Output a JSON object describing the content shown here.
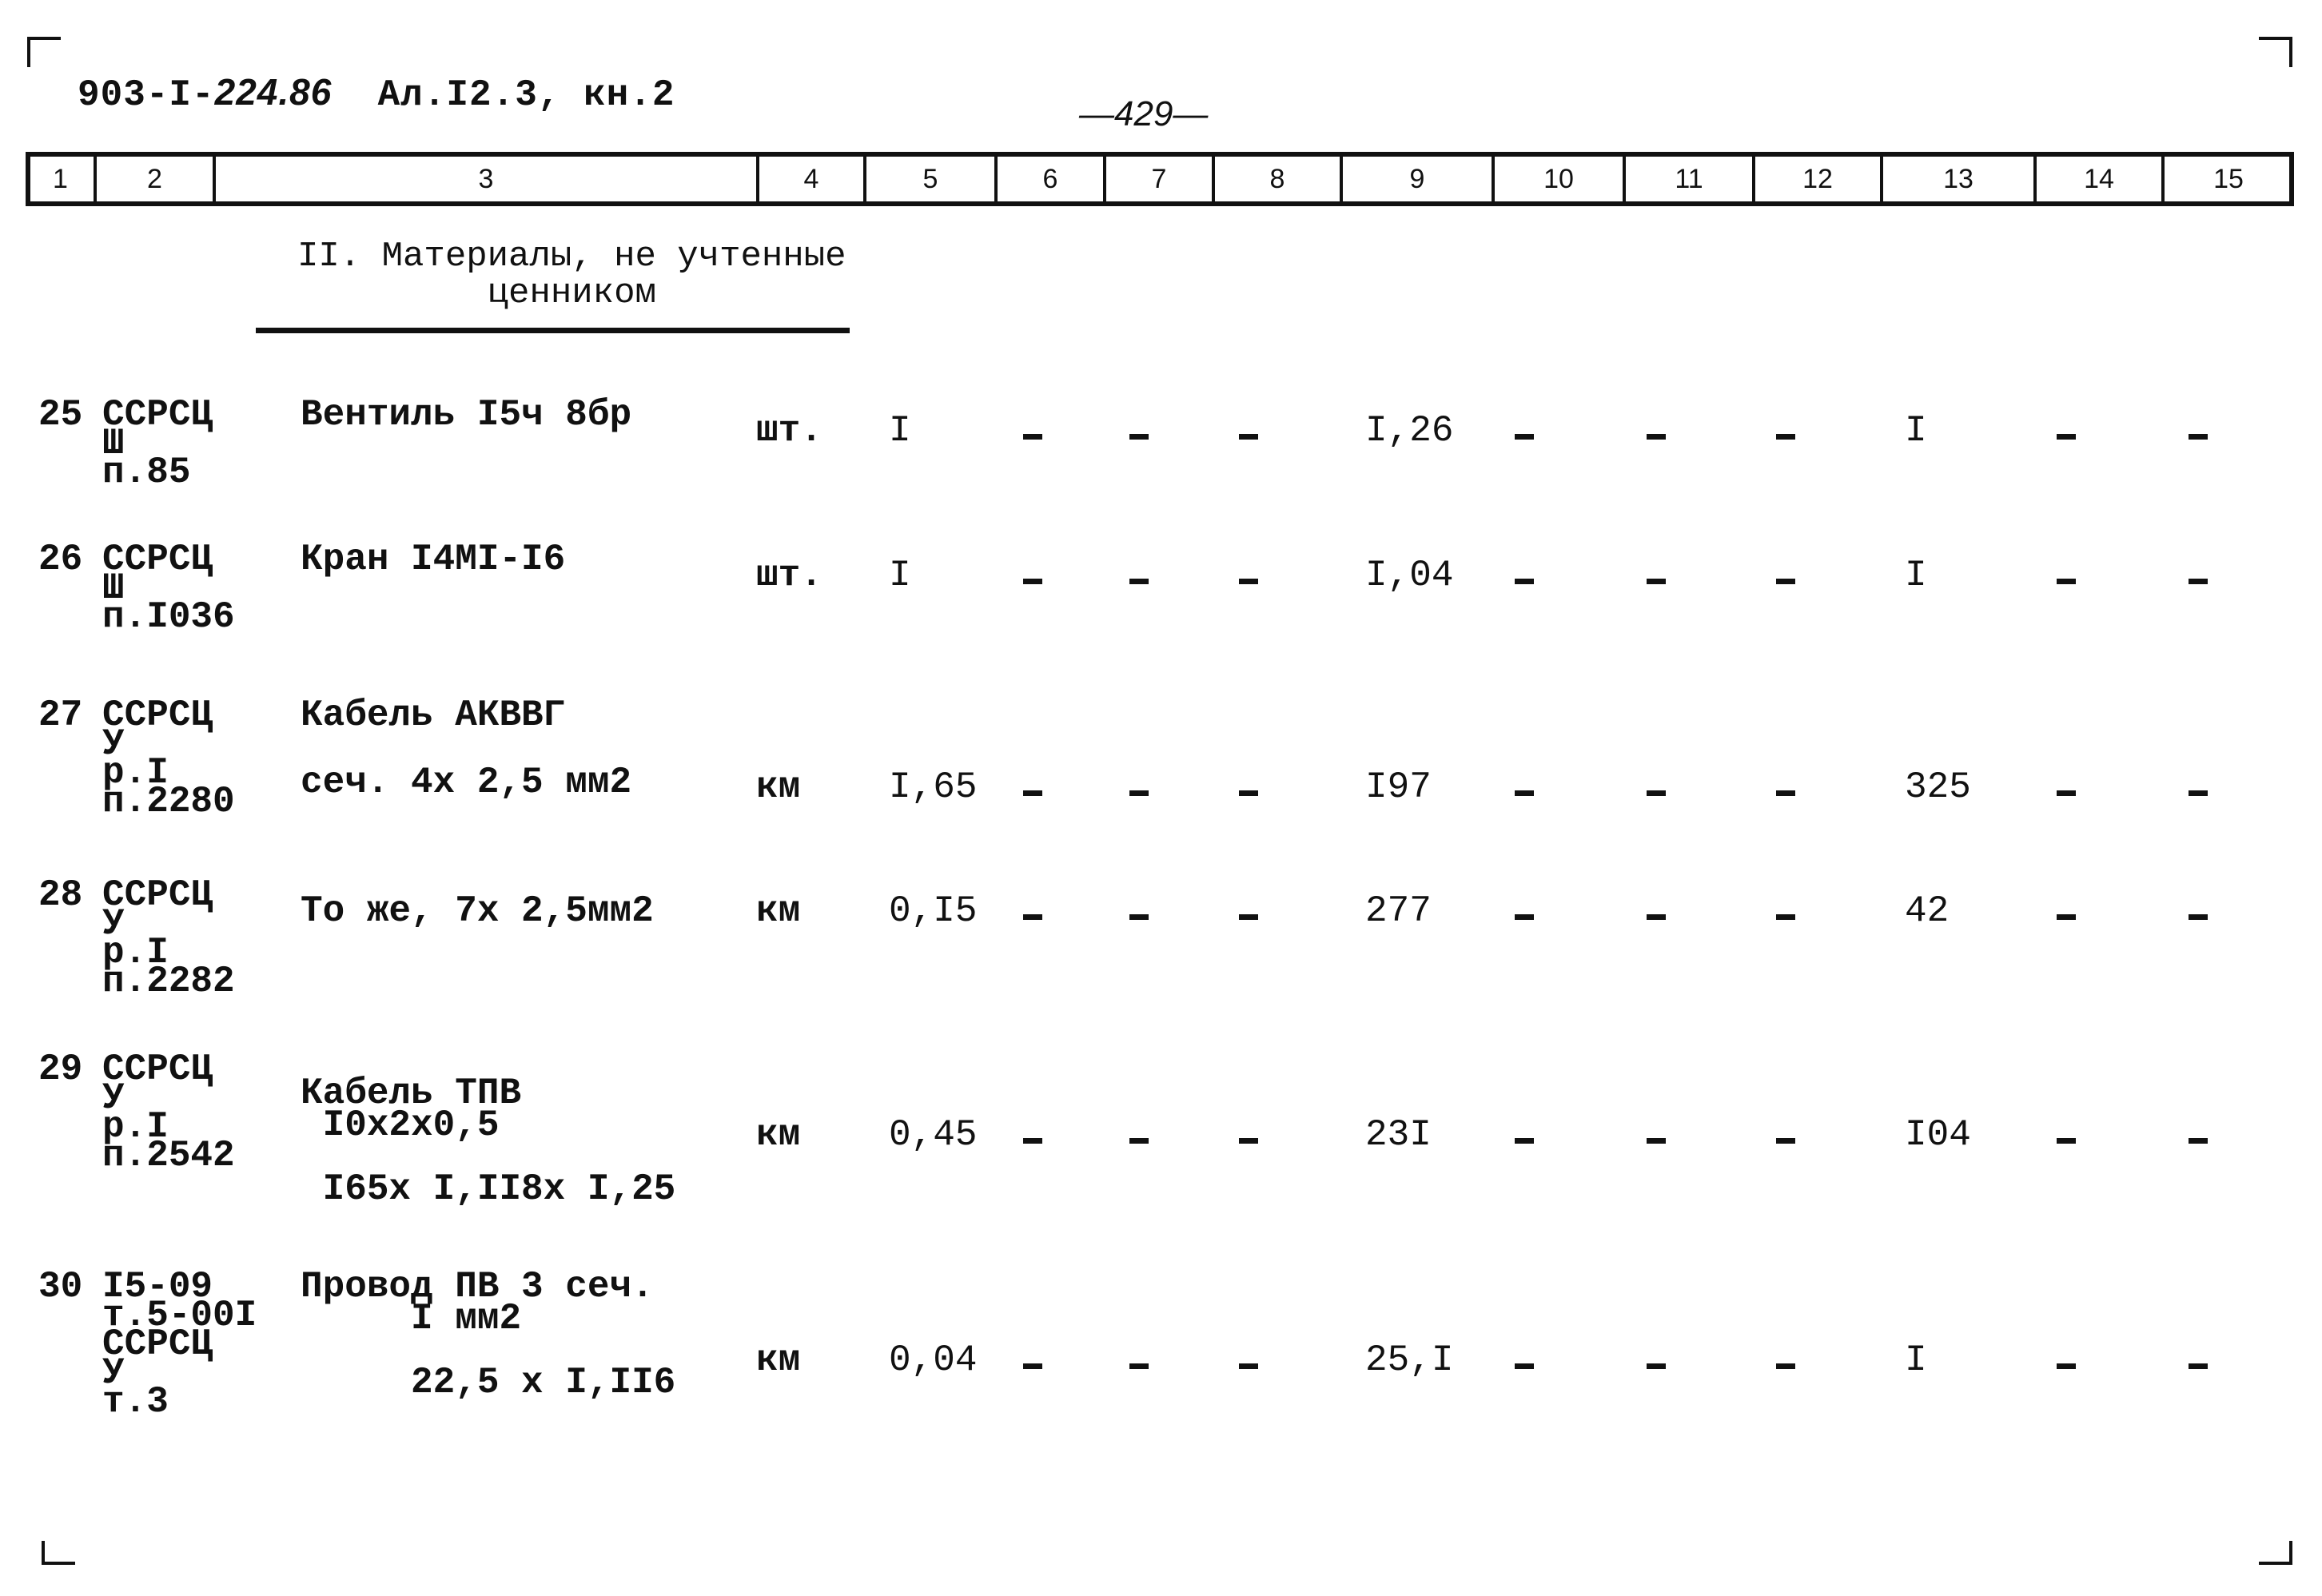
{
  "document": {
    "code_prefix": "903-I-",
    "code_hand": "224.86",
    "code_suffix": "Ал.I2.3, кн.2",
    "page_number": "—429—"
  },
  "header_columns": [
    "1",
    "2",
    "3",
    "4",
    "5",
    "6",
    "7",
    "8",
    "9",
    "10",
    "11",
    "12",
    "13",
    "14",
    "15"
  ],
  "section": {
    "title_line1": "II. Материалы, не учтенные",
    "title_line2": "ценником"
  },
  "rows": [
    {
      "num": "25",
      "ref": [
        "ССРСЦ",
        "Ш",
        "п.85"
      ],
      "name": [
        "Вентиль I5ч 8бр"
      ],
      "unit": "шт.",
      "c5": "I",
      "c6": "-",
      "c7": "-",
      "c8": "-",
      "c9": "I,26",
      "c10": "-",
      "c11": "-",
      "c12": "-",
      "c13": "I",
      "c14": "-",
      "c15": "-"
    },
    {
      "num": "26",
      "ref": [
        "ССРСЦ",
        "Ш",
        "п.I036"
      ],
      "name": [
        "Кран I4МI-I6"
      ],
      "unit": "шт.",
      "c5": "I",
      "c6": "-",
      "c7": "-",
      "c8": "-",
      "c9": "I,04",
      "c10": "-",
      "c11": "-",
      "c12": "-",
      "c13": "I",
      "c14": "-",
      "c15": "-"
    },
    {
      "num": "27",
      "ref": [
        "ССРСЦ",
        "У",
        "р.I",
        "п.2280"
      ],
      "name": [
        "Кабель АКВВГ",
        "сеч. 4х 2,5 мм2"
      ],
      "unit": "км",
      "c5": "I,65",
      "c6": "-",
      "c7": "-",
      "c8": "-",
      "c9": "I97",
      "c10": "-",
      "c11": "-",
      "c12": "-",
      "c13": "325",
      "c14": "-",
      "c15": "-"
    },
    {
      "num": "28",
      "ref": [
        "ССРСЦ",
        "У",
        "р.I",
        "п.2282"
      ],
      "name": [
        "То же, 7х 2,5мм2"
      ],
      "unit": "км",
      "c5": "0,I5",
      "c6": "-",
      "c7": "-",
      "c8": "-",
      "c9": "277",
      "c10": "-",
      "c11": "-",
      "c12": "-",
      "c13": "42",
      "c14": "-",
      "c15": "-"
    },
    {
      "num": "29",
      "ref": [
        "ССРСЦ",
        "У",
        "р.I",
        "п.2542"
      ],
      "name": [
        "Кабель ТПВ",
        " I0x2x0,5",
        "",
        " I65x I,II8x I,25"
      ],
      "unit": "км",
      "c5": "0,45",
      "c6": "-",
      "c7": "-",
      "c8": "-",
      "c9": "23I",
      "c10": "-",
      "c11": "-",
      "c12": "-",
      "c13": "I04",
      "c14": "-",
      "c15": "-"
    },
    {
      "num": "30",
      "ref": [
        "I5-09",
        "т.5-00I",
        "ССРСЦ",
        "У",
        "т.3"
      ],
      "name": [
        "Провод ПВ 3 сеч.",
        "     I мм2",
        "",
        "     22,5 х I,II6"
      ],
      "unit": "км",
      "c5": "0,04",
      "c6": "-",
      "c7": "-",
      "c8": "-",
      "c9": "25,I",
      "c10": "-",
      "c11": "-",
      "c12": "-",
      "c13": "I",
      "c14": "-",
      "c15": "-"
    }
  ]
}
